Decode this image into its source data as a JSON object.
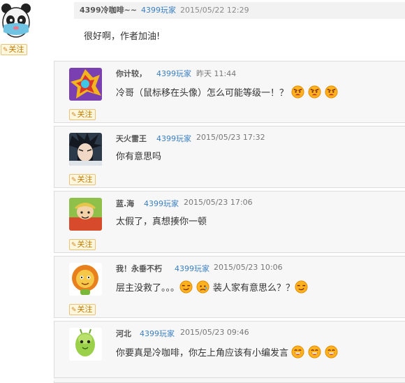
{
  "follow_label": "关注",
  "main_comment": {
    "username": "4399冷咖啡~~",
    "role": "4399玩家",
    "time": "2015/05/22 12:29",
    "text": "很好啊，作者加油!"
  },
  "replies": [
    {
      "username": "你计较，",
      "role": "4399玩家",
      "time": "昨天 11:44",
      "text": "冷哥（鼠标移在头像）怎么可能等级一！？",
      "emojis": [
        "angry-face-icon",
        "angry-face-icon",
        "angry-face-icon"
      ]
    },
    {
      "username": "天火雷王",
      "role": "4399玩家",
      "time": "2015/05/23 17:32",
      "text": "你有意思吗"
    },
    {
      "username": "蓝.海",
      "role": "4399玩家",
      "time": "2015/05/23 17:06",
      "text": "太假了，真想揍你一顿"
    },
    {
      "username": "我！永垂不朽",
      "role": "4399玩家",
      "time": "2015/05/23 10:06",
      "text_before": "层主没救了。。。",
      "text_after": "装人家有意思么？？",
      "emojis": [
        "smirk-face-icon",
        "sad-face-icon",
        "smirk-face-icon"
      ]
    },
    {
      "username": "河北",
      "role": "4399玩家",
      "time": "2015/05/23 09:46",
      "text": "你要真是冷咖啡，你左上角应该有小编发言",
      "emojis": [
        "grin-face-icon",
        "grin-face-icon",
        "grin-face-icon"
      ]
    }
  ],
  "colors": {
    "role_link": "#3a7fc2",
    "follow_bg": "#fff6dc",
    "follow_border": "#e8c37a",
    "reply_bg": "#f7f7f7",
    "header_bg": "#f2f2f2",
    "emoji_face": "#ffb21e"
  }
}
